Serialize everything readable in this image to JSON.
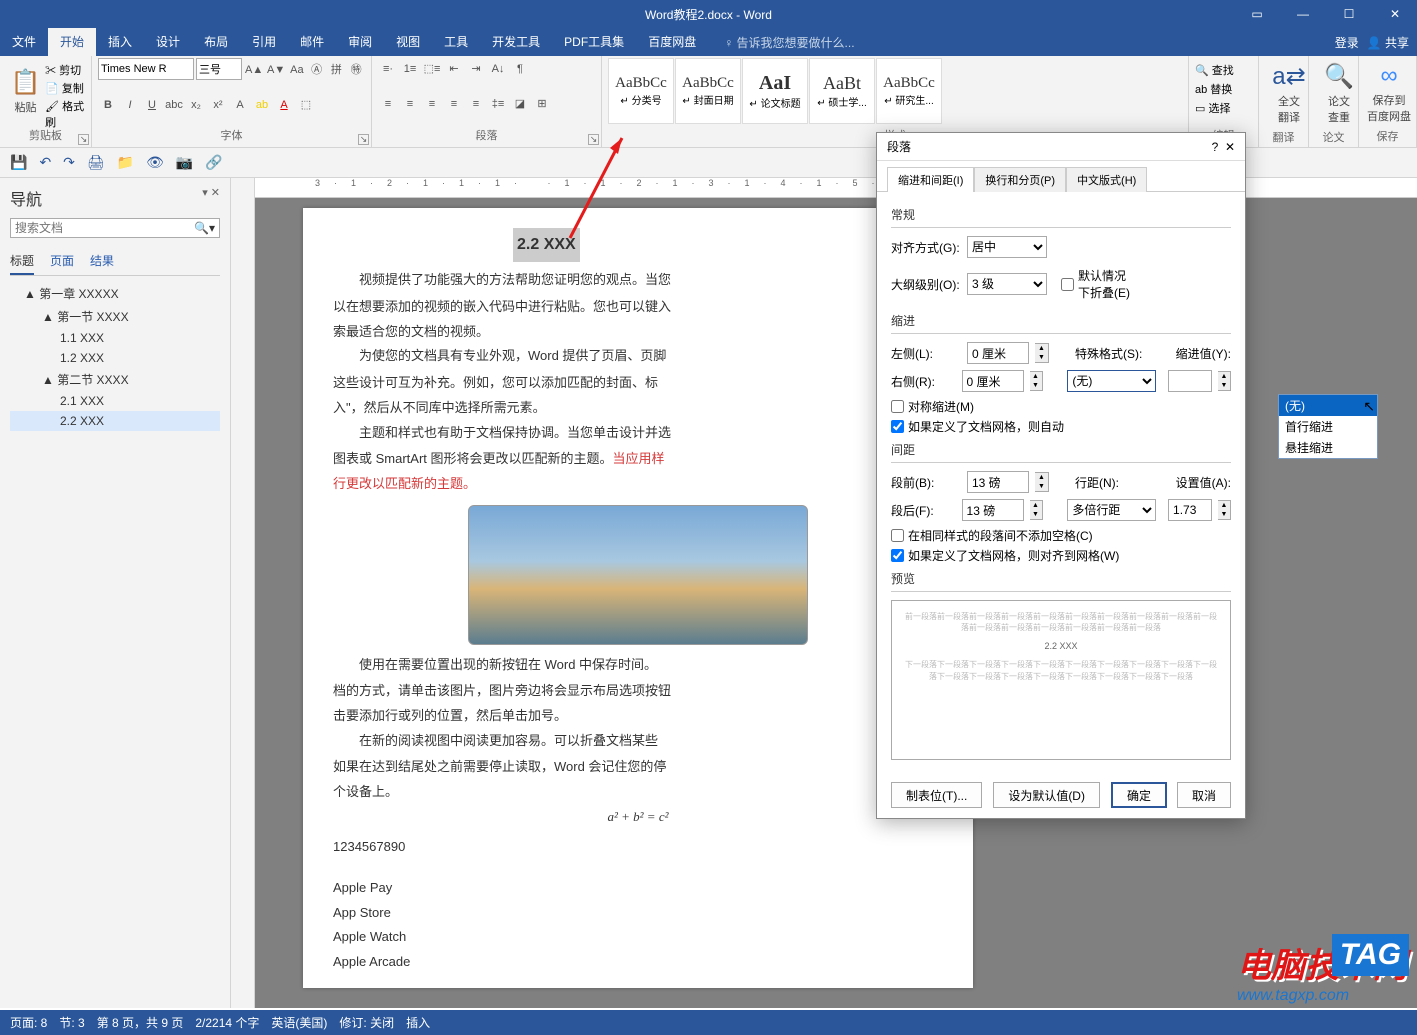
{
  "titlebar": {
    "title": "Word教程2.docx - Word"
  },
  "account": {
    "login": "登录",
    "share": "共享"
  },
  "ribbon_tabs": [
    "文件",
    "开始",
    "插入",
    "设计",
    "布局",
    "引用",
    "邮件",
    "审阅",
    "视图",
    "工具",
    "开发工具",
    "PDF工具集",
    "百度网盘"
  ],
  "ribbon_active_tab": 1,
  "tellme_placeholder": "告诉我您想要做什么...",
  "clipboard": {
    "paste": "粘贴",
    "cut": "剪切",
    "copy": "复制",
    "painter": "格式刷",
    "group": "剪贴板"
  },
  "font": {
    "family": "Times New R",
    "size": "三号",
    "group": "字体"
  },
  "paragraph": {
    "group": "段落"
  },
  "styles": {
    "group": "样式",
    "items": [
      {
        "preview": "AaBbCc",
        "name": "↵ 分类号"
      },
      {
        "preview": "AaBbCc",
        "name": "↵ 封面日期"
      },
      {
        "preview": "AaI",
        "name": "↵ 论文标题"
      },
      {
        "preview": "AaBt",
        "name": "↵ 硕士学..."
      },
      {
        "preview": "AaBbCc",
        "name": "↵ 研究生..."
      }
    ]
  },
  "editing": {
    "find": "查找",
    "replace": "替换",
    "select": "选择",
    "group": "编辑"
  },
  "extra_groups": {
    "translate": {
      "label": "全文\n翻译",
      "group": "翻译"
    },
    "lookup": {
      "label": "论文\n查重",
      "group": "论文"
    },
    "baidu": {
      "label": "保存到\n百度网盘",
      "group": "保存"
    }
  },
  "qat_icons": [
    "💾",
    "↶",
    "↷",
    "🖨",
    "📁",
    "👁",
    "📷",
    "🔗"
  ],
  "navpane": {
    "title": "导航",
    "search_placeholder": "搜索文档",
    "tabs": [
      "标题",
      "页面",
      "结果"
    ],
    "active_tab": 0,
    "tree": [
      {
        "lvl": 1,
        "text": "第一章 XXXXX",
        "exp": true
      },
      {
        "lvl": 2,
        "text": "第一节 XXXX",
        "exp": true
      },
      {
        "lvl": 3,
        "text": "1.1 XXX"
      },
      {
        "lvl": 3,
        "text": "1.2 XXX"
      },
      {
        "lvl": 2,
        "text": "第二节 XXXX",
        "exp": true
      },
      {
        "lvl": 3,
        "text": "2.1 XXX"
      },
      {
        "lvl": 3,
        "text": "2.2 XXX",
        "sel": true
      }
    ]
  },
  "document": {
    "heading": "2.2 XXX",
    "p1": "视频提供了功能强大的方法帮助您证明您的观点。当您",
    "p1b": "以在想要添加的视频的嵌入代码中进行粘贴。您也可以键入",
    "p1c": "索最适合您的文档的视频。",
    "p2": "为使您的文档具有专业外观，Word 提供了页眉、页脚",
    "p2b": "这些设计可互为补充。例如，您可以添加匹配的封面、标",
    "p2c": "入\"，然后从不同库中选择所需元素。",
    "p3": "主题和样式也有助于文档保持协调。当您单击设计并选",
    "p3b": "图表或 SmartArt 图形将会更改以匹配新的主题。",
    "p3red": "当应用样",
    "p3c": "行更改以匹配新的主题。",
    "p4": "使用在需要位置出现的新按钮在 Word 中保存时间。",
    "p4b": "档的方式，请单击该图片，图片旁边将会显示布局选项按钮",
    "p4c": "击要添加行或列的位置，然后单击加号。",
    "p5": "在新的阅读视图中阅读更加容易。可以折叠文档某些",
    "p5b": "如果在达到结尾处之前需要停止读取，Word 会记住您的停",
    "p5c": "个设备上。",
    "formula": "a² + b² = c²",
    "numbers": "1234567890",
    "applelist": [
      "Apple Pay",
      "App Store",
      "Apple Watch",
      "Apple Arcade"
    ]
  },
  "dialog": {
    "title": "段落",
    "tabs": [
      "缩进和间距(I)",
      "换行和分页(P)",
      "中文版式(H)"
    ],
    "active_tab": 0,
    "general_label": "常规",
    "alignment_label": "对齐方式(G):",
    "alignment_value": "居中",
    "outline_label": "大纲级别(O):",
    "outline_value": "3 级",
    "collapse_cb": "默认情况下折叠(E)",
    "indent_label": "缩进",
    "left_label": "左侧(L):",
    "left_value": "0 厘米",
    "right_label": "右侧(R):",
    "right_value": "0 厘米",
    "special_label": "特殊格式(S):",
    "special_value": "(无)",
    "special_options": [
      "(无)",
      "首行缩进",
      "悬挂缩进"
    ],
    "special_selected": 0,
    "indent_value_label": "缩进值(Y):",
    "indent_value": "",
    "sym_cb": "对称缩进(M)",
    "grid_indent_cb": "如果定义了文档网格，则自动",
    "spacing_label": "间距",
    "before_label": "段前(B):",
    "before_value": "13 磅",
    "after_label": "段后(F):",
    "after_value": "13 磅",
    "line_label": "行距(N):",
    "line_value": "多倍行距",
    "setval_label": "设置值(A):",
    "setval_value": "1.73",
    "nospace_cb": "在相同样式的段落间不添加空格(C)",
    "grid_align_cb": "如果定义了文档网格，则对齐到网格(W)",
    "preview_label": "预览",
    "preview_title": "2.2 XXX",
    "btn_tabs": "制表位(T)...",
    "btn_default": "设为默认值(D)",
    "btn_ok": "确定",
    "btn_cancel": "取消"
  },
  "statusbar": {
    "page": "页面: 8",
    "section": "节: 3",
    "pages": "第 8 页，共 9 页",
    "words": "2/2214 个字",
    "lang": "英语(美国)",
    "track": "修订: 关闭",
    "insert": "插入"
  },
  "watermark": {
    "cn": "电脑技术网",
    "tag": "TAG",
    "url": "www.tagxp.com"
  }
}
